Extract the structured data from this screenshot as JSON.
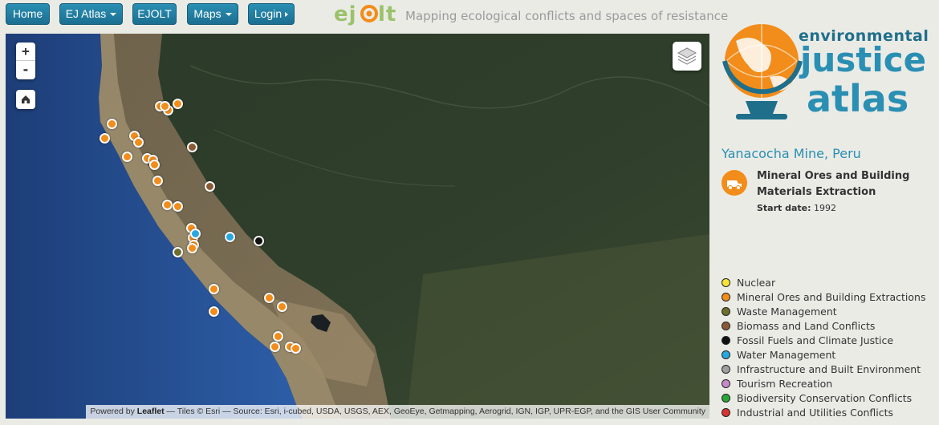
{
  "nav": {
    "buttons": [
      {
        "label": "Home",
        "type": "plain"
      },
      {
        "label": "EJ Atlas",
        "type": "dropdown"
      },
      {
        "label": "EJOLT",
        "type": "plain"
      },
      {
        "label": "Maps",
        "type": "dropdown"
      },
      {
        "label": "Login",
        "type": "arrow"
      }
    ],
    "ejolt_logo": "ejolt",
    "tagline": "Mapping ecological conflicts and spaces of resistance"
  },
  "map": {
    "zoom_in": "+",
    "zoom_out": "-",
    "attribution": {
      "prefix": "Powered by ",
      "leaflet": "Leaflet",
      "rest": " — Tiles © Esri — Source: Esri, i-cubed, USDA, USGS, AEX, GeoEye, Getmapping, Aerogrid, IGN, IGP, UPR-EGP, and the GIS User Community"
    },
    "markers": [
      {
        "category": "Mineral Ores and Building Extractions",
        "color": "#f28c1a"
      },
      {
        "category": "Mineral Ores and Building Extractions",
        "color": "#f28c1a"
      },
      {
        "category": "Mineral Ores and Building Extractions",
        "color": "#f28c1a"
      },
      {
        "category": "Mineral Ores and Building Extractions",
        "color": "#f28c1a"
      },
      {
        "category": "Mineral Ores and Building Extractions",
        "color": "#f28c1a"
      },
      {
        "category": "Mineral Ores and Building Extractions",
        "color": "#f28c1a"
      },
      {
        "category": "Mineral Ores and Building Extractions",
        "color": "#f28c1a"
      },
      {
        "category": "Mineral Ores and Building Extractions",
        "color": "#f28c1a"
      },
      {
        "category": "Mineral Ores and Building Extractions",
        "color": "#f28c1a"
      },
      {
        "category": "Mineral Ores and Building Extractions",
        "color": "#f28c1a"
      },
      {
        "category": "Mineral Ores and Building Extractions",
        "color": "#f28c1a"
      },
      {
        "category": "Mineral Ores and Building Extractions",
        "color": "#f28c1a"
      },
      {
        "category": "Mineral Ores and Building Extractions",
        "color": "#f28c1a"
      },
      {
        "category": "Mineral Ores and Building Extractions",
        "color": "#f28c1a"
      },
      {
        "category": "Mineral Ores and Building Extractions",
        "color": "#f28c1a"
      },
      {
        "category": "Mineral Ores and Building Extractions",
        "color": "#f28c1a"
      },
      {
        "category": "Mineral Ores and Building Extractions",
        "color": "#f28c1a"
      },
      {
        "category": "Mineral Ores and Building Extractions",
        "color": "#f28c1a"
      },
      {
        "category": "Mineral Ores and Building Extractions",
        "color": "#f28c1a"
      },
      {
        "category": "Mineral Ores and Building Extractions",
        "color": "#f28c1a"
      },
      {
        "category": "Mineral Ores and Building Extractions",
        "color": "#f28c1a"
      },
      {
        "category": "Mineral Ores and Building Extractions",
        "color": "#f28c1a"
      },
      {
        "category": "Mineral Ores and Building Extractions",
        "color": "#f28c1a"
      },
      {
        "category": "Mineral Ores and Building Extractions",
        "color": "#f28c1a"
      },
      {
        "category": "Mineral Ores and Building Extractions",
        "color": "#f28c1a"
      },
      {
        "category": "Mineral Ores and Building Extractions",
        "color": "#f28c1a"
      },
      {
        "category": "Mineral Ores and Building Extractions",
        "color": "#f28c1a"
      },
      {
        "category": "Biomass and Land Conflicts",
        "color": "#8a5a36"
      },
      {
        "category": "Biomass and Land Conflicts",
        "color": "#8a5a36"
      },
      {
        "category": "Waste Management",
        "color": "#6e6e2e"
      },
      {
        "category": "Water Management",
        "color": "#29a8e0"
      },
      {
        "category": "Water Management",
        "color": "#29a8e0"
      },
      {
        "category": "Fossil Fuels and Climate Justice",
        "color": "#111111"
      }
    ]
  },
  "sidebar": {
    "logo": {
      "line1": "environmental",
      "line2": "justice",
      "line3": "atlas"
    },
    "case_title": "Yanacocha Mine, Peru",
    "category": "Mineral Ores and Building Materials Extraction",
    "start_date_label": "Start date:",
    "start_date_value": "1992",
    "legend": [
      {
        "label": "Nuclear",
        "color": "#f5e536"
      },
      {
        "label": "Mineral Ores and Building Extractions",
        "color": "#f28c1a"
      },
      {
        "label": "Waste Management",
        "color": "#6e6e2e"
      },
      {
        "label": "Biomass and Land Conflicts",
        "color": "#8a5a36"
      },
      {
        "label": "Fossil Fuels and Climate Justice",
        "color": "#111111"
      },
      {
        "label": "Water Management",
        "color": "#29a8e0"
      },
      {
        "label": "Infrastructure and Built Environment",
        "color": "#a0a0a0"
      },
      {
        "label": "Tourism Recreation",
        "color": "#c58ac9"
      },
      {
        "label": "Biodiversity Conservation Conflicts",
        "color": "#2aa53a"
      },
      {
        "label": "Industrial and Utilities Conflicts",
        "color": "#d93434"
      }
    ]
  }
}
